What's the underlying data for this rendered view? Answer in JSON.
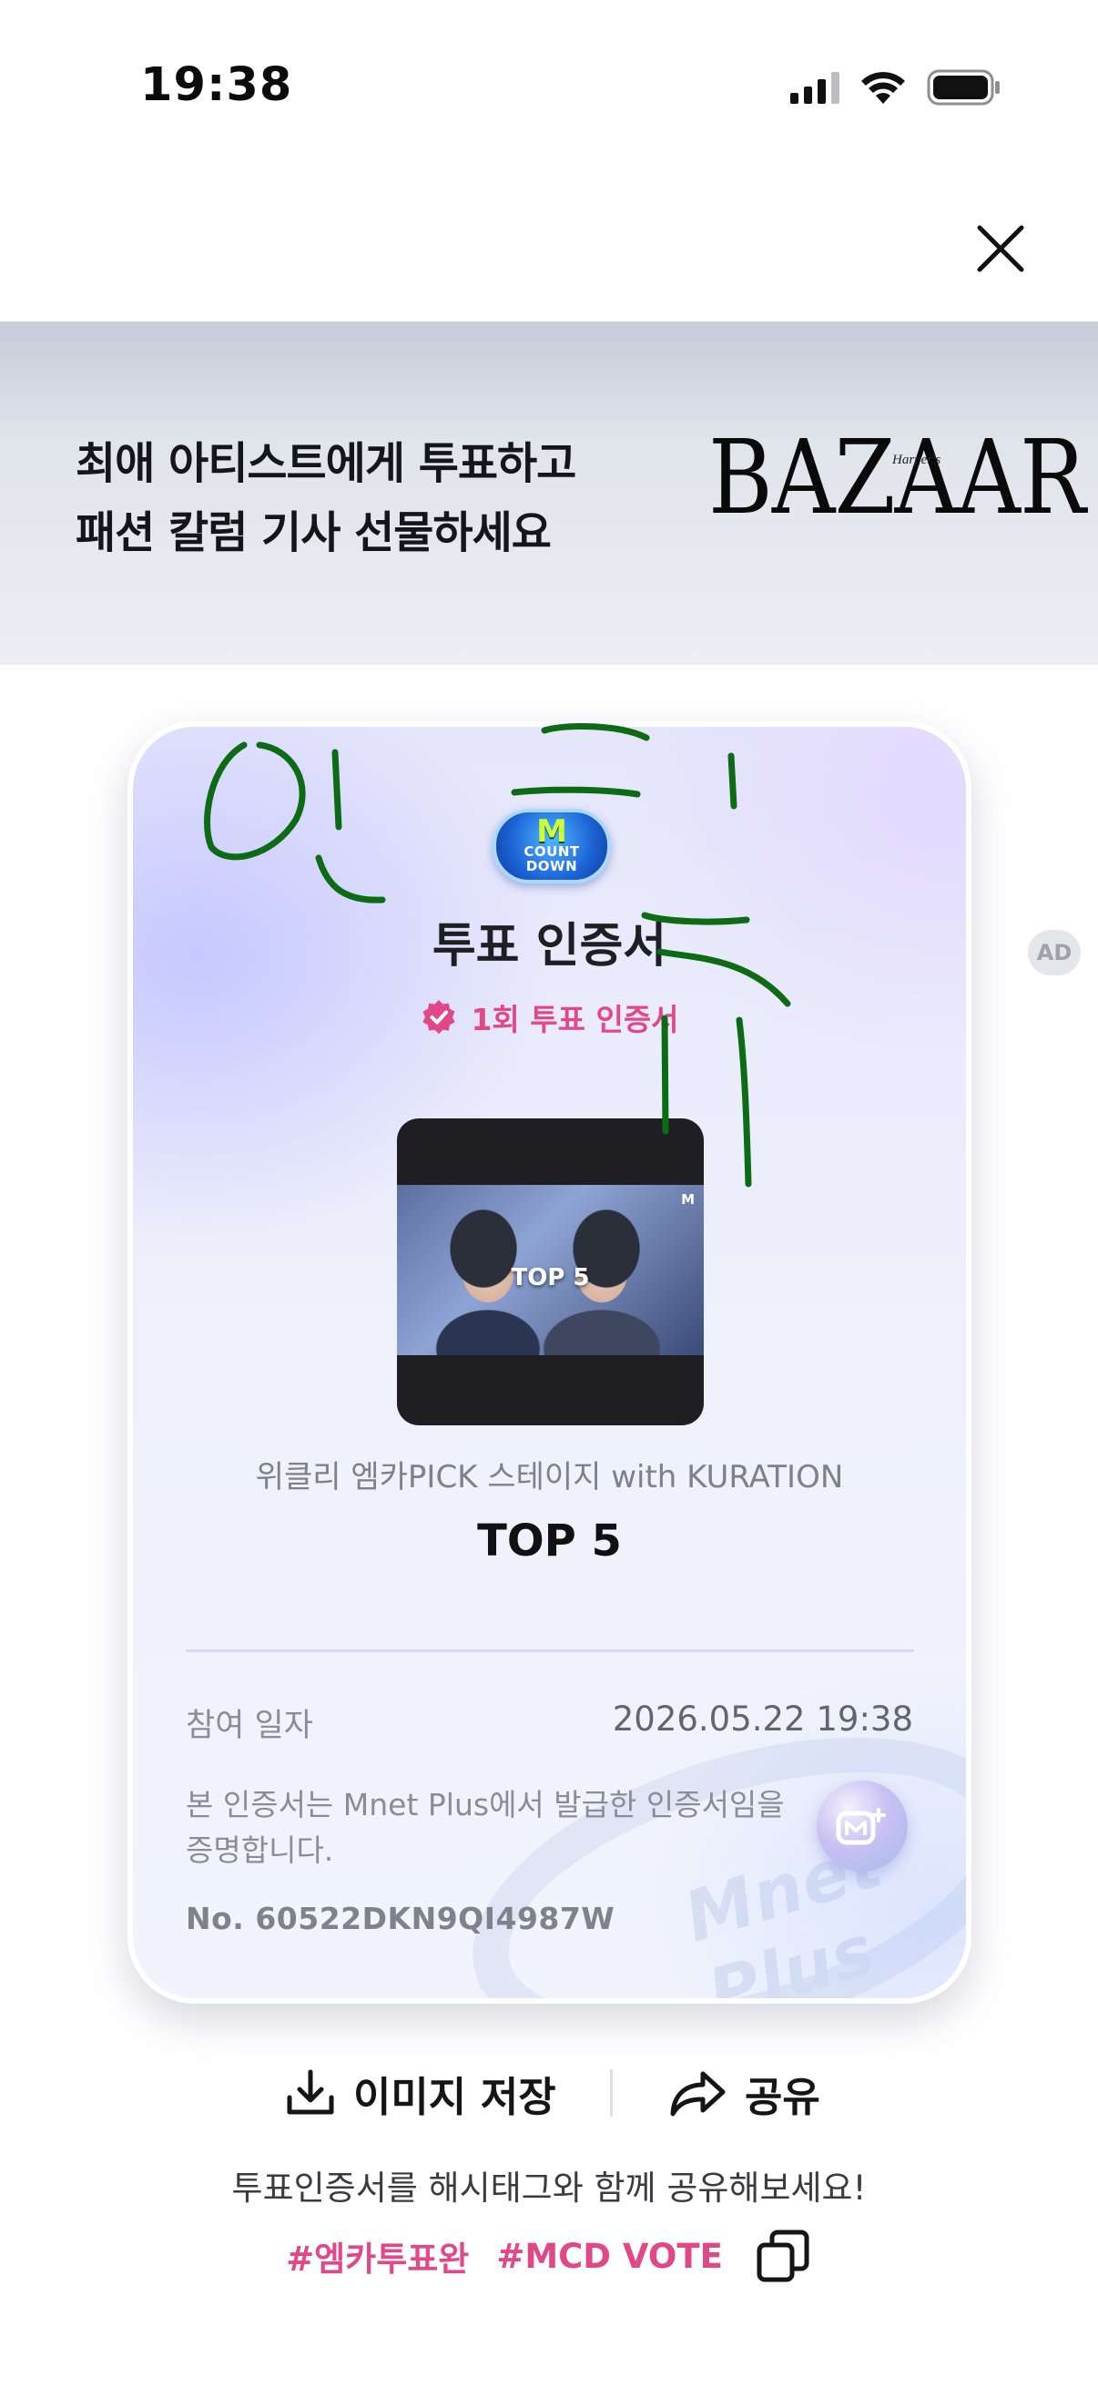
{
  "status_bar": {
    "time": "19:38"
  },
  "ad": {
    "line1": "최애 아티스트에게 투표하고",
    "line2": "패션 칼럼 기사 선물하세요",
    "brand": "BAZAAR",
    "brand_small": "Harper's",
    "badge": "AD"
  },
  "certificate": {
    "logo_mark": "M",
    "logo_text_1": "COUNT",
    "logo_text_2": "DOWN",
    "title": "투표 인증서",
    "subtitle": "1회 투표 인증서",
    "thumbnail_caption": "TOP 5",
    "thumbnail_mark": "M",
    "program": "위클리 엠카PICK 스테이지 with KURATION",
    "rank": "TOP 5",
    "date_label": "참여 일자",
    "date_value": "2026.05.22 19:38",
    "issue_note": "본 인증서는 Mnet Plus에서 발급한 인증서임을 증명합니다.",
    "serial": "No. 60522DKN9QI4987W",
    "watermark": "Mnet Plus",
    "accent_color": "#e04888"
  },
  "actions": {
    "save_label": "이미지 저장",
    "share_label": "공유"
  },
  "share_guide": "투표인증서를 해시태그와 함께 공유해보세요!",
  "hashtags": [
    "#엠카투표완",
    "#MCD VOTE"
  ]
}
